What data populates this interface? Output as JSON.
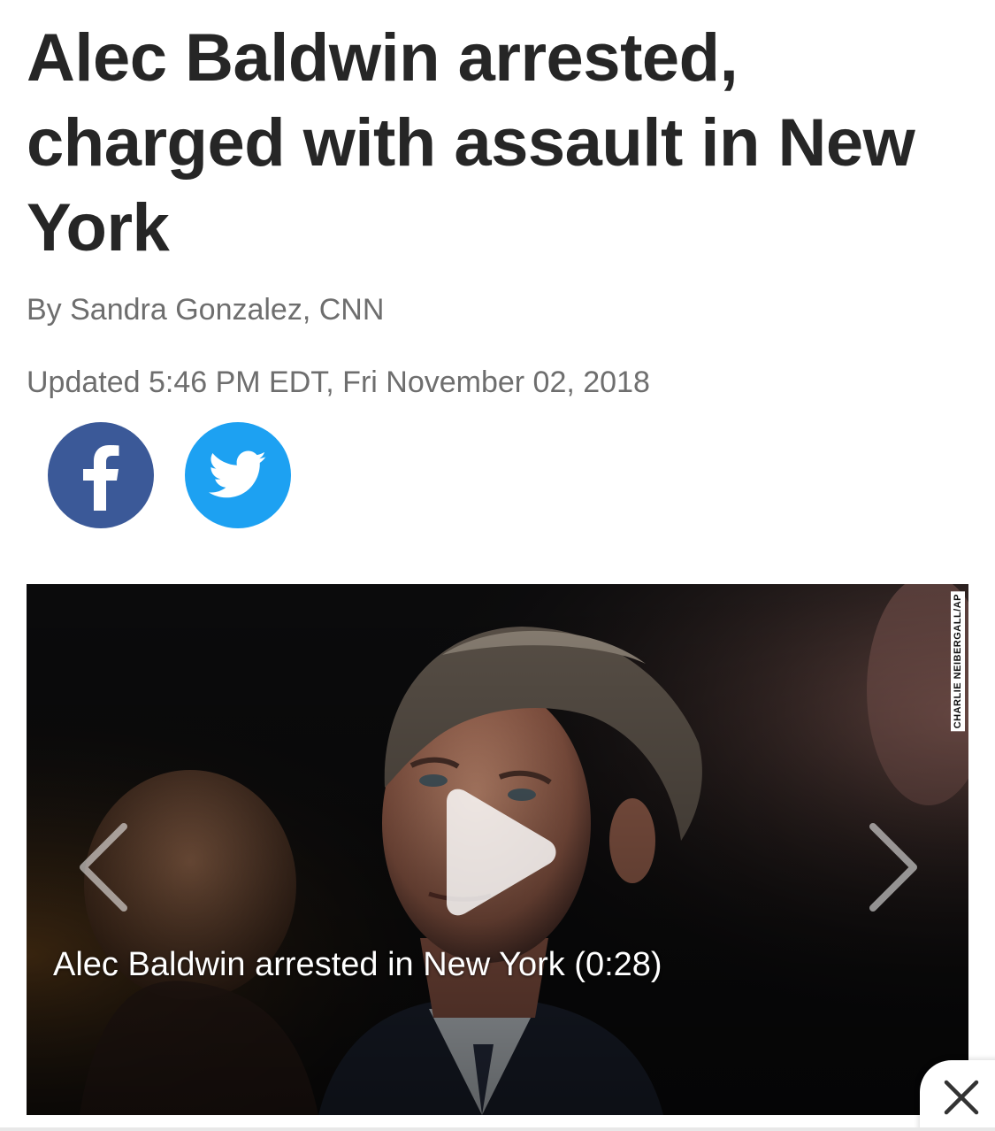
{
  "article": {
    "headline": "Alec Baldwin arrested, charged with assault in New York",
    "byline": "By Sandra Gonzalez, CNN",
    "updated": "Updated 5:46 PM EDT, Fri November 02, 2018"
  },
  "share": {
    "facebook_icon": "facebook-icon",
    "twitter_icon": "twitter-bird-icon"
  },
  "video": {
    "caption": "Alec Baldwin arrested in New York (0:28)",
    "photo_credit": "CHARLIE NEIBERGALL/AP",
    "play_icon": "play-icon",
    "prev_icon": "chevron-left-icon",
    "next_icon": "chevron-right-icon"
  },
  "overlay": {
    "close_icon": "close-icon"
  },
  "colors": {
    "facebook": "#3b5998",
    "twitter": "#1da1f2",
    "headline": "#262626",
    "meta_text": "#6e6e6e"
  }
}
